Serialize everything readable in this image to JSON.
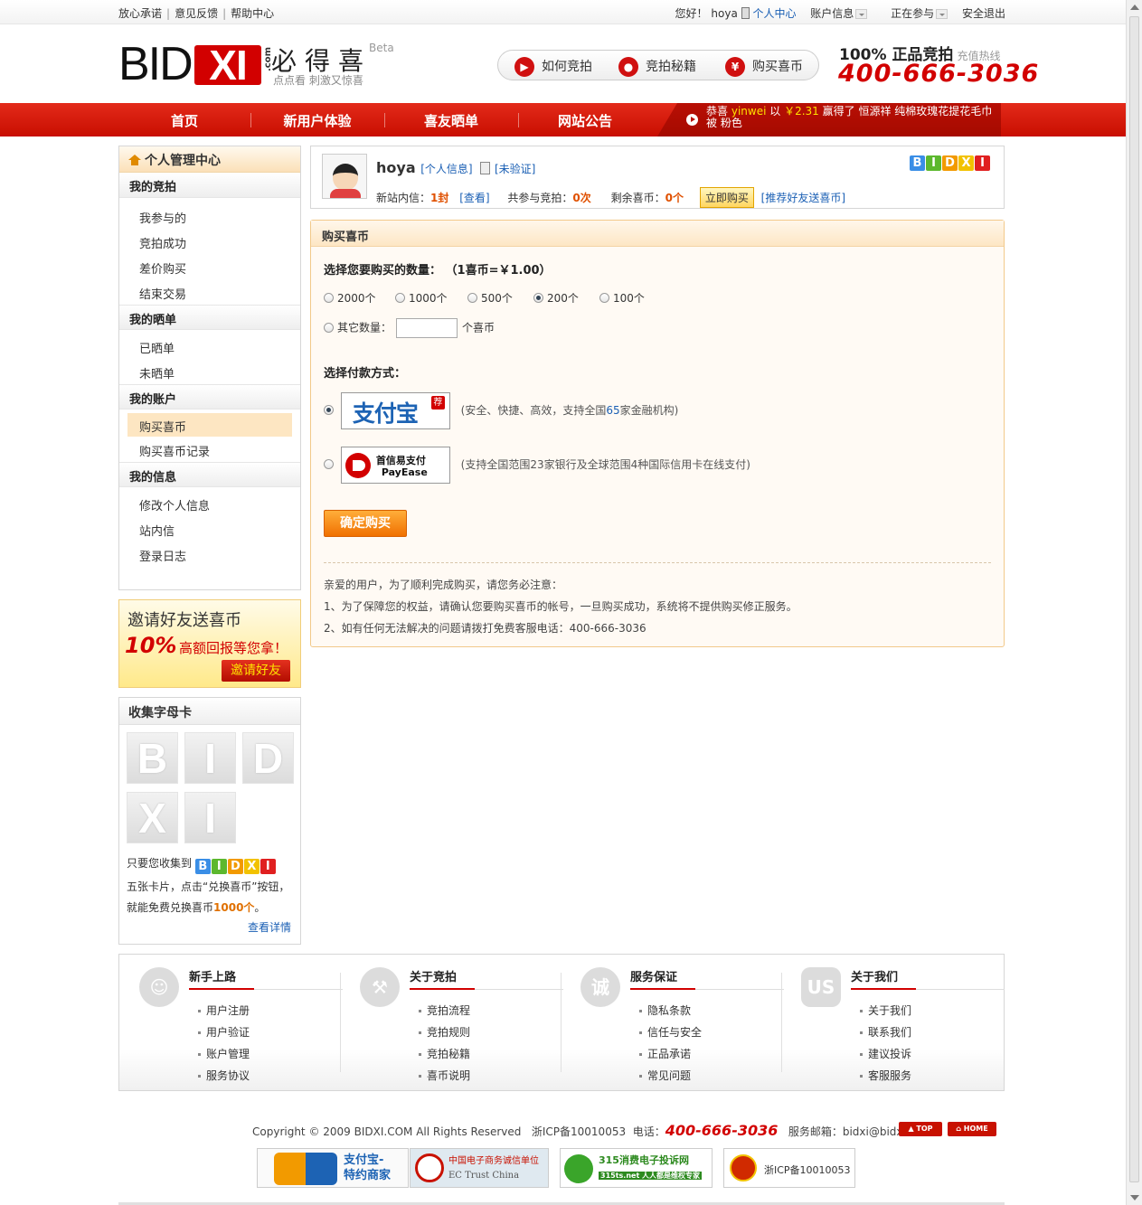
{
  "topbar": {
    "links": [
      "放心承诺",
      "意见反馈",
      "帮助中心"
    ],
    "greeting": "您好！",
    "username": "hoya",
    "user_center": "个人中心",
    "account_info": "账户信息",
    "participating": "正在参与",
    "logout": "安全退出"
  },
  "header": {
    "logo_text_black": "BID",
    "logo_text_red": "XI",
    "logo_com": ".com",
    "cn_name": "必得喜",
    "beta": "Beta",
    "slogan": "点点看  刺激又惊喜",
    "nav_pills": [
      {
        "icon": "play-icon",
        "label": "如何竞拍"
      },
      {
        "icon": "thermometer-icon",
        "label": "竞拍秘籍"
      },
      {
        "icon": "yen-icon",
        "label": "购买喜币"
      }
    ],
    "hotline_title": "100% 正品竞拍",
    "hotline_sub": "充值热线",
    "hotline_number": "400-666-3036"
  },
  "mainnav": {
    "items": [
      "首页",
      "新用户体验",
      "喜友晒单",
      "网站公告"
    ],
    "ticker_prefix": "恭喜",
    "ticker_user": "yinwei",
    "ticker_mid": "以",
    "ticker_price": "￥2.31",
    "ticker_suffix": "赢得了 恒源祥 纯棉玫瑰花提花毛巾 被 粉色"
  },
  "sidebar": {
    "title": "个人管理中心",
    "sections": [
      {
        "title": "我的竞拍",
        "items": [
          "我参与的",
          "竞拍成功",
          "差价购买",
          "结束交易"
        ]
      },
      {
        "title": "我的晒单",
        "items": [
          "已晒单",
          "未晒单"
        ]
      },
      {
        "title": "我的账户",
        "items": [
          "购买喜币",
          "购买喜币记录"
        ]
      },
      {
        "title": "我的信息",
        "items": [
          "修改个人信息",
          "站内信",
          "登录日志"
        ]
      }
    ],
    "active_item": "购买喜币"
  },
  "invite": {
    "line1": "邀请好友送喜币",
    "percent": "10%",
    "line2": "高额回报等您拿！",
    "button": "邀请好友"
  },
  "collect": {
    "title": "收集字母卡",
    "cards": [
      "B",
      "I",
      "D",
      "X",
      "I"
    ],
    "text1": "只要您收集到",
    "text2": "五张卡片，点击“兑换喜币”按钮，",
    "text3": "就能免费兑换喜币",
    "amount": "1000个",
    "period": "。",
    "more": "查看详情"
  },
  "brand_letters": [
    {
      "ch": "B",
      "color": "#3a8ee6"
    },
    {
      "ch": "I",
      "color": "#5cb82e"
    },
    {
      "ch": "D",
      "color": "#f29a00"
    },
    {
      "ch": "X",
      "color": "#f2c200"
    },
    {
      "ch": "I",
      "color": "#e02020"
    }
  ],
  "user": {
    "name": "hoya",
    "info_link": "[个人信息]",
    "verify_link": "[未验证]",
    "msg_label": "新站内信：",
    "msg_count": "1封",
    "msg_view": "[查看]",
    "joined_label": "共参与竞拍：",
    "joined_count": "0次",
    "coins_label": "剩余喜币：",
    "coins_count": "0个",
    "buy_now": "立即购买",
    "recommend": "[推荐好友送喜币]"
  },
  "purchase": {
    "title": "购买喜币",
    "qty_label": "选择您要购买的数量：",
    "rate": "（1喜币=￥1.00）",
    "options": [
      "2000个",
      "1000个",
      "500个",
      "200个",
      "100个"
    ],
    "selected": "200个",
    "other_label": "其它数量：",
    "other_value": "",
    "other_unit": "个喜币",
    "pay_label": "选择付款方式：",
    "alipay_name": "支付宝",
    "alipay_tag": "荐",
    "alipay_desc_a": "(安全、快捷、高效，支持全国",
    "alipay_desc_num": "65",
    "alipay_desc_b": "家金融机构)",
    "payease_name1": "首信易支付",
    "payease_name2": "PayEase",
    "payease_desc": "(支持全国范围23家银行及全球范围4种国际信用卡在线支付)",
    "confirm": "确定购买",
    "note_title": "亲爱的用户，为了顺利完成购买，请您务必注意：",
    "note1": "1、为了保障您的权益，请确认您要购买喜币的帐号，一旦购买成功，系统将不提供购买修正服务。",
    "note2": "2、如有任何无法解决的问题请拨打免费客服电话：400-666-3036"
  },
  "footer": {
    "columns": [
      {
        "icon": "person-icon",
        "glyph": "☺",
        "title": "新手上路",
        "links": [
          "用户注册",
          "用户验证",
          "账户管理",
          "服务协议"
        ]
      },
      {
        "icon": "gavel-icon",
        "glyph": "⚒",
        "title": "关于竞拍",
        "links": [
          "竞拍流程",
          "竞拍规则",
          "竞拍秘籍",
          "喜币说明"
        ]
      },
      {
        "icon": "integrity-icon",
        "glyph": "诚",
        "title": "服务保证",
        "links": [
          "隐私条款",
          "信任与安全",
          "正品承诺",
          "常见问题"
        ]
      },
      {
        "icon": "us-icon",
        "glyph": "US",
        "title": "关于我们",
        "links": [
          "关于我们",
          "联系我们",
          "建议投诉",
          "客服服务"
        ]
      }
    ],
    "copyright": "Copyright © 2009 BIDXI.COM All Rights Reserved",
    "icp": "浙ICP备10010053",
    "tel_label": "电话：",
    "tel": "400-666-3036",
    "email_label": "服务邮箱：",
    "email": "bidxi@bidxi.com",
    "top_btn": "TOP",
    "home_btn": "HOME",
    "badges": [
      {
        "line1": "支付宝-",
        "line2": "特约商家"
      },
      {
        "line1": "中国电子商务诚信单位",
        "line2": "EC Trust China"
      },
      {
        "line1": "315消费电子投诉网",
        "line2": "315ts.net 人人都是维权专家"
      },
      {
        "line1": "浙ICP备10010053",
        "line2": ""
      }
    ]
  }
}
